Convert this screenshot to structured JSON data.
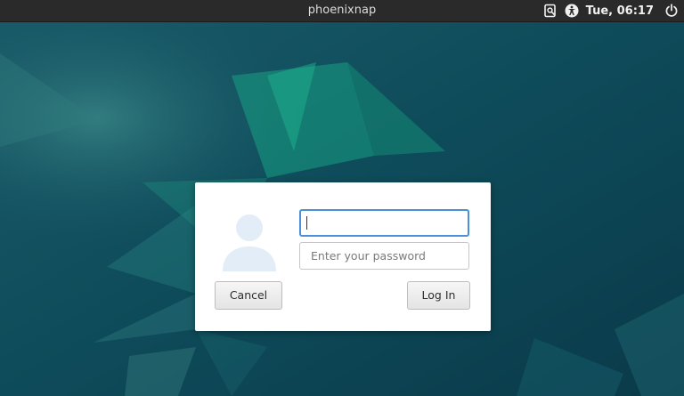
{
  "topbar": {
    "hostname": "phoenixnap",
    "clock": "Tue, 06:17",
    "icons": [
      "screen-recorder-icon",
      "accessibility-icon",
      "power-icon"
    ]
  },
  "login": {
    "username_value": "",
    "password_placeholder": "Enter your password",
    "cancel_label": "Cancel",
    "login_label": "Log In"
  },
  "colors": {
    "background": "#0f4a5c",
    "accent_teal": "#1aa088",
    "focus_ring": "#4a90d9",
    "topbar": "#2a2a2a"
  }
}
